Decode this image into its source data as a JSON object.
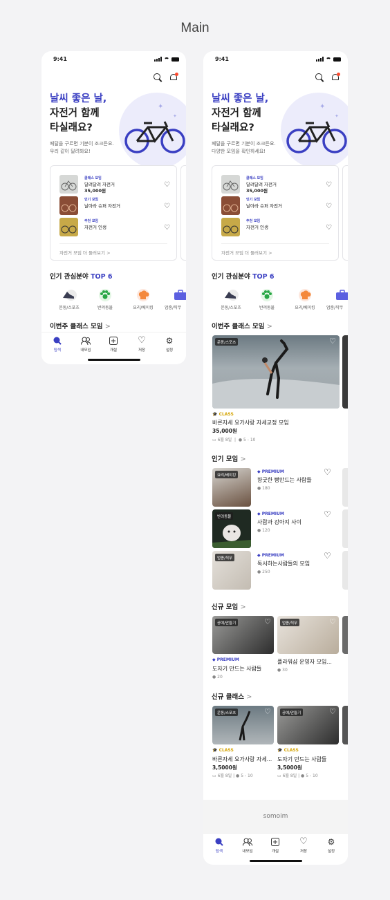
{
  "page_title": "Main",
  "status_time": "9:41",
  "hero": {
    "title_accent": "날씨 좋은 날,",
    "title_line2": "자전거 함께",
    "title_line3": "타실래요?",
    "sub1_a": "페달을 구르면 기분이 조크든요.",
    "sub2_a": "우리 같이 달려봐요!",
    "sub1_b": "페달을 구르면 기분이 조크든요.",
    "sub2_b": "다양한 모임을 확인하세요!"
  },
  "rec_card": {
    "items": [
      {
        "category": "클래스 모임",
        "name": "달려달려 자전거",
        "price": "35,000원"
      },
      {
        "category": "인기 모임",
        "name": "날아라 슈퍼 자전거",
        "price": ""
      },
      {
        "category": "추천 모임",
        "name": "자전거 인생",
        "price": ""
      }
    ],
    "more": "자전거 모임 더 둘러보기 >"
  },
  "interest": {
    "title_pre": "인기 관심분야",
    "title_accent": "TOP 6",
    "categories": [
      "운동/스포츠",
      "반려동물",
      "요리/베이킹",
      "업종/직무",
      "업종/직무"
    ]
  },
  "weekly_class": {
    "title": "이번주 클래스 모임",
    "items": [
      {
        "tag": "운동/스포츠",
        "badge": "CLASS",
        "name": "바른자세 요가사랑 자세교정 모임",
        "price": "35,000원",
        "date": "6월 8일",
        "people": "5 - 10"
      }
    ]
  },
  "popular": {
    "title": "인기 모임",
    "items": [
      {
        "tag": "요리/베이킹",
        "badge": "PREMIUM",
        "name": "향긋한 빵만드는 사람들",
        "count": "180"
      },
      {
        "tag": "반려동물",
        "badge": "PREMIUM",
        "name": "사람과 강아지 사이",
        "count": "120"
      },
      {
        "tag": "업종/직무",
        "badge": "PREMIUM",
        "name": "독서하는사람들의 모임",
        "count": "250"
      }
    ]
  },
  "new_groups": {
    "title": "신규 모임",
    "items": [
      {
        "tag": "공예/만들기",
        "badge": "PREMIUM",
        "name": "도자기 만드는 사람들",
        "count": "20"
      },
      {
        "tag": "업종/직무",
        "badge": "",
        "name": "플라워샵 운영자 모임...",
        "count": "30"
      }
    ]
  },
  "new_classes": {
    "title": "신규 클래스",
    "items": [
      {
        "tag": "운동/스포츠",
        "badge": "CLASS",
        "name": "바른자세 요가사랑 자세...",
        "price": "3,5000원",
        "date": "6월 8일",
        "people": "5 - 10"
      },
      {
        "tag": "공예/만들기",
        "badge": "CLASS",
        "name": "도자기 만드는 사람들",
        "price": "3,5000원",
        "date": "6월 8일",
        "people": "5 - 10"
      }
    ]
  },
  "footer_brand": "somoim",
  "tabs": [
    "탐색",
    "내모임",
    "개설",
    "저장",
    "설정"
  ],
  "colors": {
    "accent": "#3a3fc2",
    "class_badge": "#d4a300",
    "notification": "#ff4a2f"
  }
}
